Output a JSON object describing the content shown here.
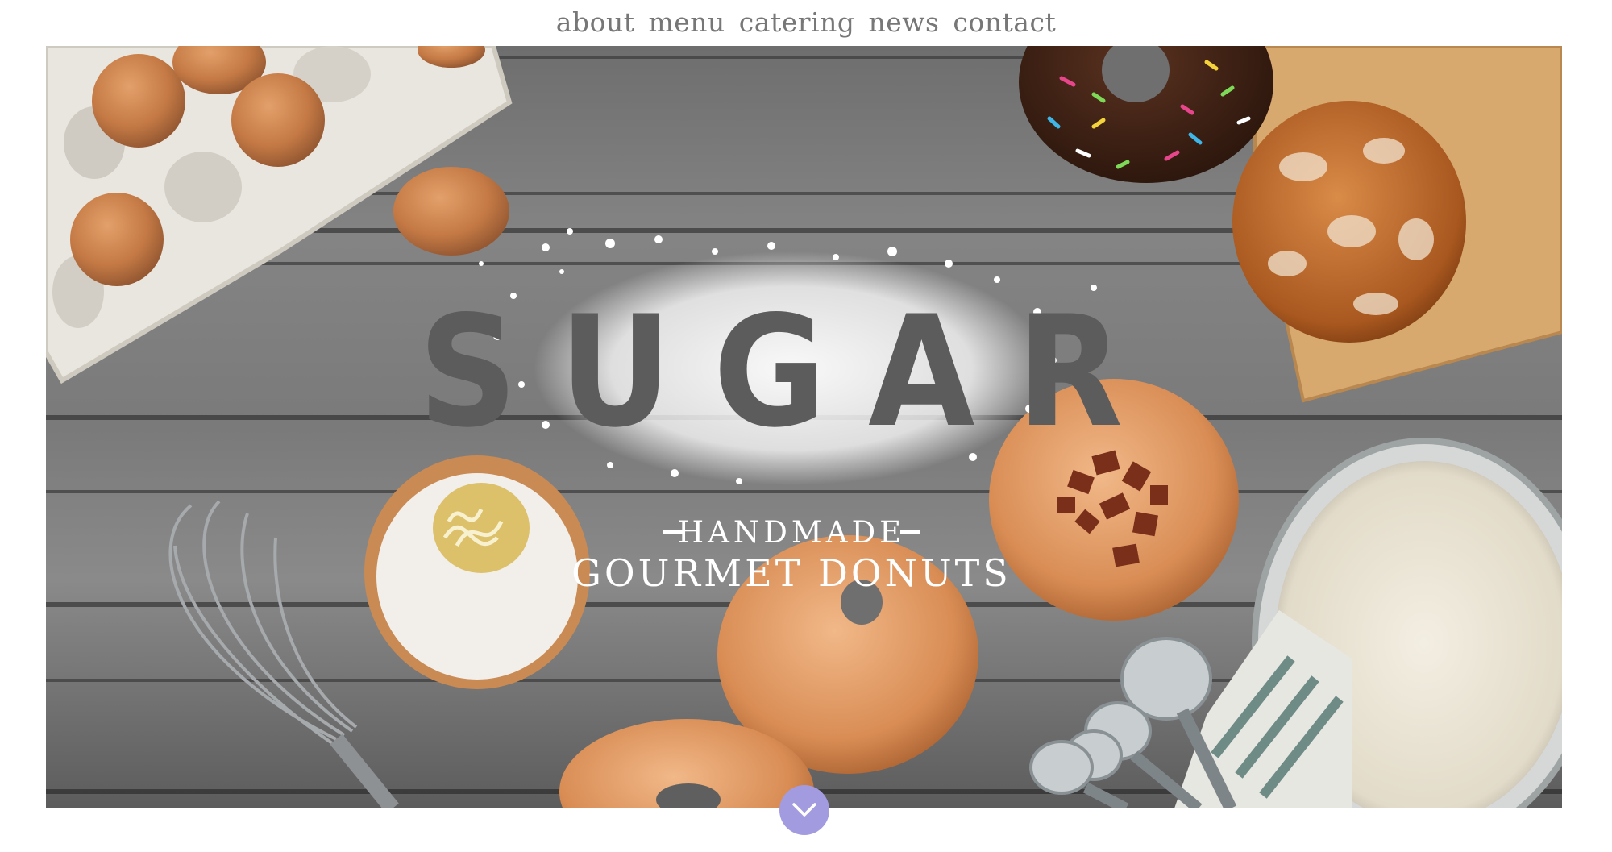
{
  "nav": {
    "items": [
      {
        "label": "about"
      },
      {
        "label": "menu"
      },
      {
        "label": "catering"
      },
      {
        "label": "news"
      },
      {
        "label": "contact"
      }
    ]
  },
  "hero": {
    "logo": "SUGAR",
    "tagline_top": "HANDMADE",
    "tagline_bottom": "GOURMET DONUTS"
  },
  "scroll_button": {
    "icon": "chevron-down-icon",
    "color": "#a29be0"
  }
}
